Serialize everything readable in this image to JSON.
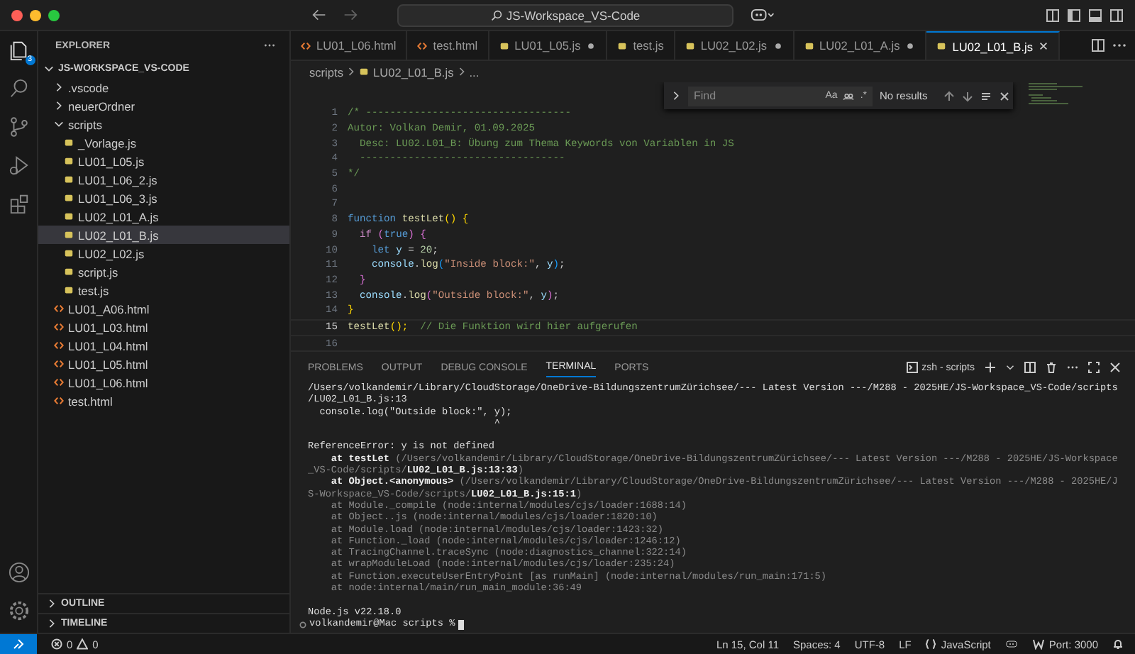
{
  "title_bar": {
    "search": "JS-Workspace_VS-Code"
  },
  "activity_bar": {
    "explorer_badge": "3"
  },
  "sidebar": {
    "title": "EXPLORER",
    "tree": [
      {
        "label": "JS-WORKSPACE_VS-CODE",
        "kind": "root",
        "expanded": true,
        "selected": false,
        "children": [
          {
            "label": ".vscode",
            "kind": "folder",
            "expanded": false,
            "selected": false
          },
          {
            "label": "neuerOrdner",
            "kind": "folder",
            "expanded": false,
            "selected": false
          },
          {
            "label": "scripts",
            "kind": "folder",
            "expanded": true,
            "selected": false,
            "children": [
              {
                "label": "_Vorlage.js",
                "kind": "js",
                "selected": false
              },
              {
                "label": "LU01_L05.js",
                "kind": "js",
                "selected": false
              },
              {
                "label": "LU01_L06_2.js",
                "kind": "js",
                "selected": false
              },
              {
                "label": "LU01_L06_3.js",
                "kind": "js",
                "selected": false
              },
              {
                "label": "LU02_L01_A.js",
                "kind": "js",
                "selected": false
              },
              {
                "label": "LU02_L01_B.js",
                "kind": "js",
                "selected": true
              },
              {
                "label": "LU02_L02.js",
                "kind": "js",
                "selected": false
              },
              {
                "label": "script.js",
                "kind": "js",
                "selected": false
              },
              {
                "label": "test.js",
                "kind": "js",
                "selected": false
              }
            ]
          },
          {
            "label": "LU01_A06.html",
            "kind": "html",
            "selected": false
          },
          {
            "label": "LU01_L03.html",
            "kind": "html",
            "selected": false
          },
          {
            "label": "LU01_L04.html",
            "kind": "html",
            "selected": false
          },
          {
            "label": "LU01_L05.html",
            "kind": "html",
            "selected": false
          },
          {
            "label": "LU01_L06.html",
            "kind": "html",
            "selected": false
          },
          {
            "label": "test.html",
            "kind": "html",
            "selected": false
          }
        ]
      }
    ],
    "sections": [
      {
        "label": "OUTLINE",
        "expanded": false
      },
      {
        "label": "TIMELINE",
        "expanded": false
      }
    ]
  },
  "tabs": [
    {
      "label": "LU01_L06.html",
      "kind": "html",
      "modified": false,
      "selected": false
    },
    {
      "label": "test.html",
      "kind": "html",
      "modified": false,
      "selected": false
    },
    {
      "label": "LU01_L05.js",
      "kind": "js",
      "modified": true,
      "selected": false
    },
    {
      "label": "test.js",
      "kind": "js",
      "modified": false,
      "selected": false
    },
    {
      "label": "LU02_L02.js",
      "kind": "js",
      "modified": true,
      "selected": false
    },
    {
      "label": "LU02_L01_A.js",
      "kind": "js",
      "modified": true,
      "selected": false
    },
    {
      "label": "LU02_L01_B.js",
      "kind": "js",
      "modified": false,
      "selected": true
    }
  ],
  "breadcrumb": [
    {
      "label": "scripts",
      "kind": "folder"
    },
    {
      "label": "LU02_L01_B.js",
      "kind": "js"
    },
    {
      "label": "...",
      "kind": "more"
    }
  ],
  "find_widget": {
    "placeholder": "Find",
    "case_label": "Aa",
    "regex_label": ".*",
    "result": "No results"
  },
  "code_lines": [
    {
      "number": "1",
      "current": false,
      "tokens": [
        {
          "text": "/* ----------------------------------",
          "kind": "comment"
        }
      ]
    },
    {
      "number": "2",
      "current": false,
      "tokens": [
        {
          "text": "Autor: Volkan Demir, 01.09.2025",
          "kind": "comment"
        }
      ]
    },
    {
      "number": "3",
      "current": false,
      "tokens": [
        {
          "text": "  Desc: LU02.L01_B: Übung zum Thema Keywords von Variablen in JS",
          "kind": "comment"
        }
      ]
    },
    {
      "number": "4",
      "current": false,
      "tokens": [
        {
          "text": "  ----------------------------------",
          "kind": "comment"
        }
      ]
    },
    {
      "number": "5",
      "current": false,
      "tokens": [
        {
          "text": "*/",
          "kind": "comment"
        }
      ]
    },
    {
      "number": "6",
      "current": false
    },
    {
      "number": "7",
      "current": false
    },
    {
      "number": "8",
      "current": false,
      "tokens": [
        {
          "text": "function",
          "kind": "keyword"
        },
        {
          "text": " testLet",
          "kind": "fn"
        },
        {
          "text": "() {",
          "kind": "brace1"
        }
      ]
    },
    {
      "number": "9",
      "current": false,
      "tokens": [
        {
          "text": "  if ",
          "kind": "control"
        },
        {
          "text": "(",
          "kind": "brace2"
        },
        {
          "text": "true",
          "kind": "keyword"
        },
        {
          "text": ") {",
          "kind": "brace2"
        }
      ]
    },
    {
      "number": "10",
      "current": false,
      "tokens": [
        {
          "text": "    let",
          "kind": "keyword"
        },
        {
          "text": " y",
          "kind": "var"
        },
        {
          "text": " = ",
          "kind": "plain"
        },
        {
          "text": "20",
          "kind": "num"
        },
        {
          "text": ";",
          "kind": "plain"
        }
      ]
    },
    {
      "number": "11",
      "current": false,
      "tokens": [
        {
          "text": "    console",
          "kind": "var"
        },
        {
          "text": ".",
          "kind": "plain"
        },
        {
          "text": "log",
          "kind": "fn"
        },
        {
          "text": "(",
          "kind": "brace3"
        },
        {
          "text": "\"Inside block:\"",
          "kind": "str"
        },
        {
          "text": ", ",
          "kind": "plain"
        },
        {
          "text": "y",
          "kind": "var"
        },
        {
          "text": ")",
          "kind": "brace3"
        },
        {
          "text": ";",
          "kind": "plain"
        }
      ]
    },
    {
      "number": "12",
      "current": false,
      "tokens": [
        {
          "text": "  }",
          "kind": "brace2"
        }
      ]
    },
    {
      "number": "13",
      "current": false,
      "tokens": [
        {
          "text": "  console",
          "kind": "var"
        },
        {
          "text": ".",
          "kind": "plain"
        },
        {
          "text": "log",
          "kind": "fn"
        },
        {
          "text": "(",
          "kind": "brace2"
        },
        {
          "text": "\"Outside block:\"",
          "kind": "str"
        },
        {
          "text": ", ",
          "kind": "plain"
        },
        {
          "text": "y",
          "kind": "var"
        },
        {
          "text": ")",
          "kind": "brace2"
        },
        {
          "text": ";",
          "kind": "plain"
        }
      ]
    },
    {
      "number": "14",
      "current": false,
      "tokens": [
        {
          "text": "}",
          "kind": "brace1"
        }
      ]
    },
    {
      "number": "15",
      "current": true,
      "tokens": [
        {
          "text": "testLet",
          "kind": "fn"
        },
        {
          "text": "();",
          "kind": "brace1"
        },
        {
          "text": "  // Die Funktion wird hier aufgerufen",
          "kind": "comment"
        }
      ]
    },
    {
      "number": "16",
      "current": false
    }
  ],
  "panel": {
    "tabs": [
      {
        "label": "PROBLEMS",
        "selected": false
      },
      {
        "label": "OUTPUT",
        "selected": false
      },
      {
        "label": "DEBUG CONSOLE",
        "selected": false
      },
      {
        "label": "TERMINAL",
        "selected": true
      },
      {
        "label": "PORTS",
        "selected": false
      }
    ],
    "terminal_title": "zsh - scripts",
    "lines": [
      {
        "segments": [
          {
            "text": "/Users/volkandemir/Library/CloudStorage/OneDrive-BildungszentrumZürichsee/--- Latest Version ---/M288 - 2025HE/JS-Workspace_VS-Code/scripts",
            "kind": "normal"
          }
        ]
      },
      {
        "segments": [
          {
            "text": "/LU02_L01_B.js:13",
            "kind": "normal"
          }
        ]
      },
      {
        "segments": [
          {
            "text": "  console.log(\"Outside block:\", y);",
            "kind": "normal"
          }
        ]
      },
      {
        "segments": [
          {
            "text": "                                ^",
            "kind": "normal"
          }
        ]
      },
      {
        "blank_before": true,
        "segments": [
          {
            "text": "ReferenceError: y is not defined",
            "kind": "normal"
          }
        ]
      },
      {
        "segments": [
          {
            "text": "    at testLet",
            "kind": "bright"
          },
          {
            "text": " (/Users/volkandemir/Library/CloudStorage/OneDrive-BildungszentrumZürichsee/--- Latest Version ---/M288 - 2025HE/JS-Workspace",
            "kind": "dim"
          }
        ]
      },
      {
        "segments": [
          {
            "text": "_VS-Code/scripts/",
            "kind": "dim"
          },
          {
            "text": "LU02_L01_B.js:13:33",
            "kind": "bright"
          },
          {
            "text": ")",
            "kind": "dim"
          }
        ]
      },
      {
        "segments": [
          {
            "text": "    at Object.<anonymous>",
            "kind": "bright"
          },
          {
            "text": " (/Users/volkandemir/Library/CloudStorage/OneDrive-BildungszentrumZürichsee/--- Latest Version ---/M288 - 2025HE/J",
            "kind": "dim"
          }
        ]
      },
      {
        "segments": [
          {
            "text": "S-Workspace_VS-Code/scripts/",
            "kind": "dim"
          },
          {
            "text": "LU02_L01_B.js:15:1",
            "kind": "bright"
          },
          {
            "text": ")",
            "kind": "dim"
          }
        ]
      },
      {
        "segments": [
          {
            "text": "    at Module._compile (node:internal/modules/cjs/loader:1688:14)",
            "kind": "dim"
          }
        ]
      },
      {
        "segments": [
          {
            "text": "    at Object..js (node:internal/modules/cjs/loader:1820:10)",
            "kind": "dim"
          }
        ]
      },
      {
        "segments": [
          {
            "text": "    at Module.load (node:internal/modules/cjs/loader:1423:32)",
            "kind": "dim"
          }
        ]
      },
      {
        "segments": [
          {
            "text": "    at Function._load (node:internal/modules/cjs/loader:1246:12)",
            "kind": "dim"
          }
        ]
      },
      {
        "segments": [
          {
            "text": "    at TracingChannel.traceSync (node:diagnostics_channel:322:14)",
            "kind": "dim"
          }
        ]
      },
      {
        "segments": [
          {
            "text": "    at wrapModuleLoad (node:internal/modules/cjs/loader:235:24)",
            "kind": "dim"
          }
        ]
      },
      {
        "segments": [
          {
            "text": "    at Function.executeUserEntryPoint [as runMain] (node:internal/modules/run_main:171:5)",
            "kind": "dim"
          }
        ]
      },
      {
        "segments": [
          {
            "text": "    at node:internal/main/run_main_module:36:49",
            "kind": "dim"
          }
        ]
      },
      {
        "blank_before": true,
        "segments": [
          {
            "text": "Node.js v22.18.0",
            "kind": "normal"
          }
        ]
      }
    ],
    "prompt": "volkandemir@Mac scripts %"
  },
  "status_bar": {
    "errors": "0",
    "warnings": "0",
    "position": "Ln 15, Col 11",
    "indent": "Spaces: 4",
    "encoding": "UTF-8",
    "eol": "LF",
    "language": "JavaScript",
    "port": "Port: 3000"
  }
}
